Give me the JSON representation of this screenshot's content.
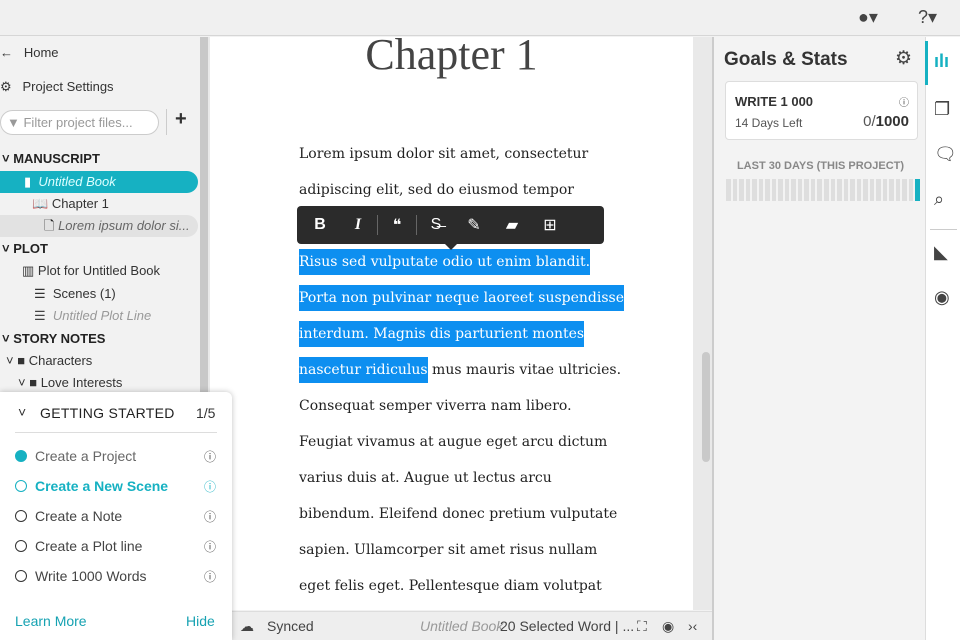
{
  "topbar": {
    "account_icon": "account-circle-icon",
    "help_icon": "help-icon"
  },
  "sidebar": {
    "home": "Home",
    "settings": "Project Settings",
    "filter_placeholder": "Filter project files...",
    "manuscript": "MANUSCRIPT",
    "book": "Untitled Book",
    "chapter": "Chapter 1",
    "scene": "Lorem ipsum dolor si...",
    "plot": "PLOT",
    "plot_book": "Plot for Untitled Book",
    "scenes": "Scenes  (1)",
    "plot_line": "Untitled Plot Line",
    "story_notes": "STORY NOTES",
    "characters": "Characters",
    "love": "Love Interests"
  },
  "getting_started": {
    "title": "GETTING STARTED",
    "progress": "1/5",
    "items": [
      {
        "label": "Create a Project",
        "state": "done"
      },
      {
        "label": "Create a New Scene",
        "state": "active"
      },
      {
        "label": "Create a Note",
        "state": "todo"
      },
      {
        "label": "Create a Plot line",
        "state": "todo"
      },
      {
        "label": "Write 1000 Words",
        "state": "todo"
      }
    ],
    "learn_more": "Learn More",
    "hide": "Hide"
  },
  "editor": {
    "chapter_title": "Chapter 1",
    "lines": [
      "Lorem ipsum dolor sit amet, consectetur",
      "adipiscing elit, sed do eiusmod tempor",
      "",
      "Risus sed vulputate odio ut enim blandit.",
      "Porta non pulvinar neque laoreet suspendisse",
      "interdum. Magnis dis parturient montes",
      "nascetur ridiculus",
      " mus mauris vitae ultricies.",
      "Consequat semper viverra nam libero.",
      "Feugiat vivamus at augue eget arcu dictum",
      "varius duis at. Augue ut lectus arcu",
      "bibendum. Eleifend donec pretium vulputate",
      "sapien. Ullamcorper sit amet risus nullam",
      "eget felis eget. Pellentesque diam volutpat"
    ],
    "toolbar": [
      "bold",
      "italic",
      "quote",
      "strikethrough",
      "highlight",
      "note",
      "comment"
    ]
  },
  "status": {
    "synced": "Synced",
    "book": "Untitled Book",
    "selection": "20 Selected Word | ..."
  },
  "goals": {
    "title": "Goals & Stats",
    "goal": "WRITE 1 000",
    "days_left": "14 Days Left",
    "progress_current": "0/",
    "progress_target": "1000",
    "last30": "LAST 30 DAYS (THIS PROJECT)",
    "daily_words": [
      0,
      0,
      0,
      0,
      0,
      0,
      0,
      0,
      0,
      0,
      0,
      0,
      0,
      0,
      0,
      0,
      0,
      0,
      0,
      0,
      0,
      0,
      0,
      0,
      0,
      0,
      0,
      0,
      0,
      1
    ]
  },
  "colors": {
    "accent": "#16b1c2",
    "selection": "#0d8ff0"
  }
}
